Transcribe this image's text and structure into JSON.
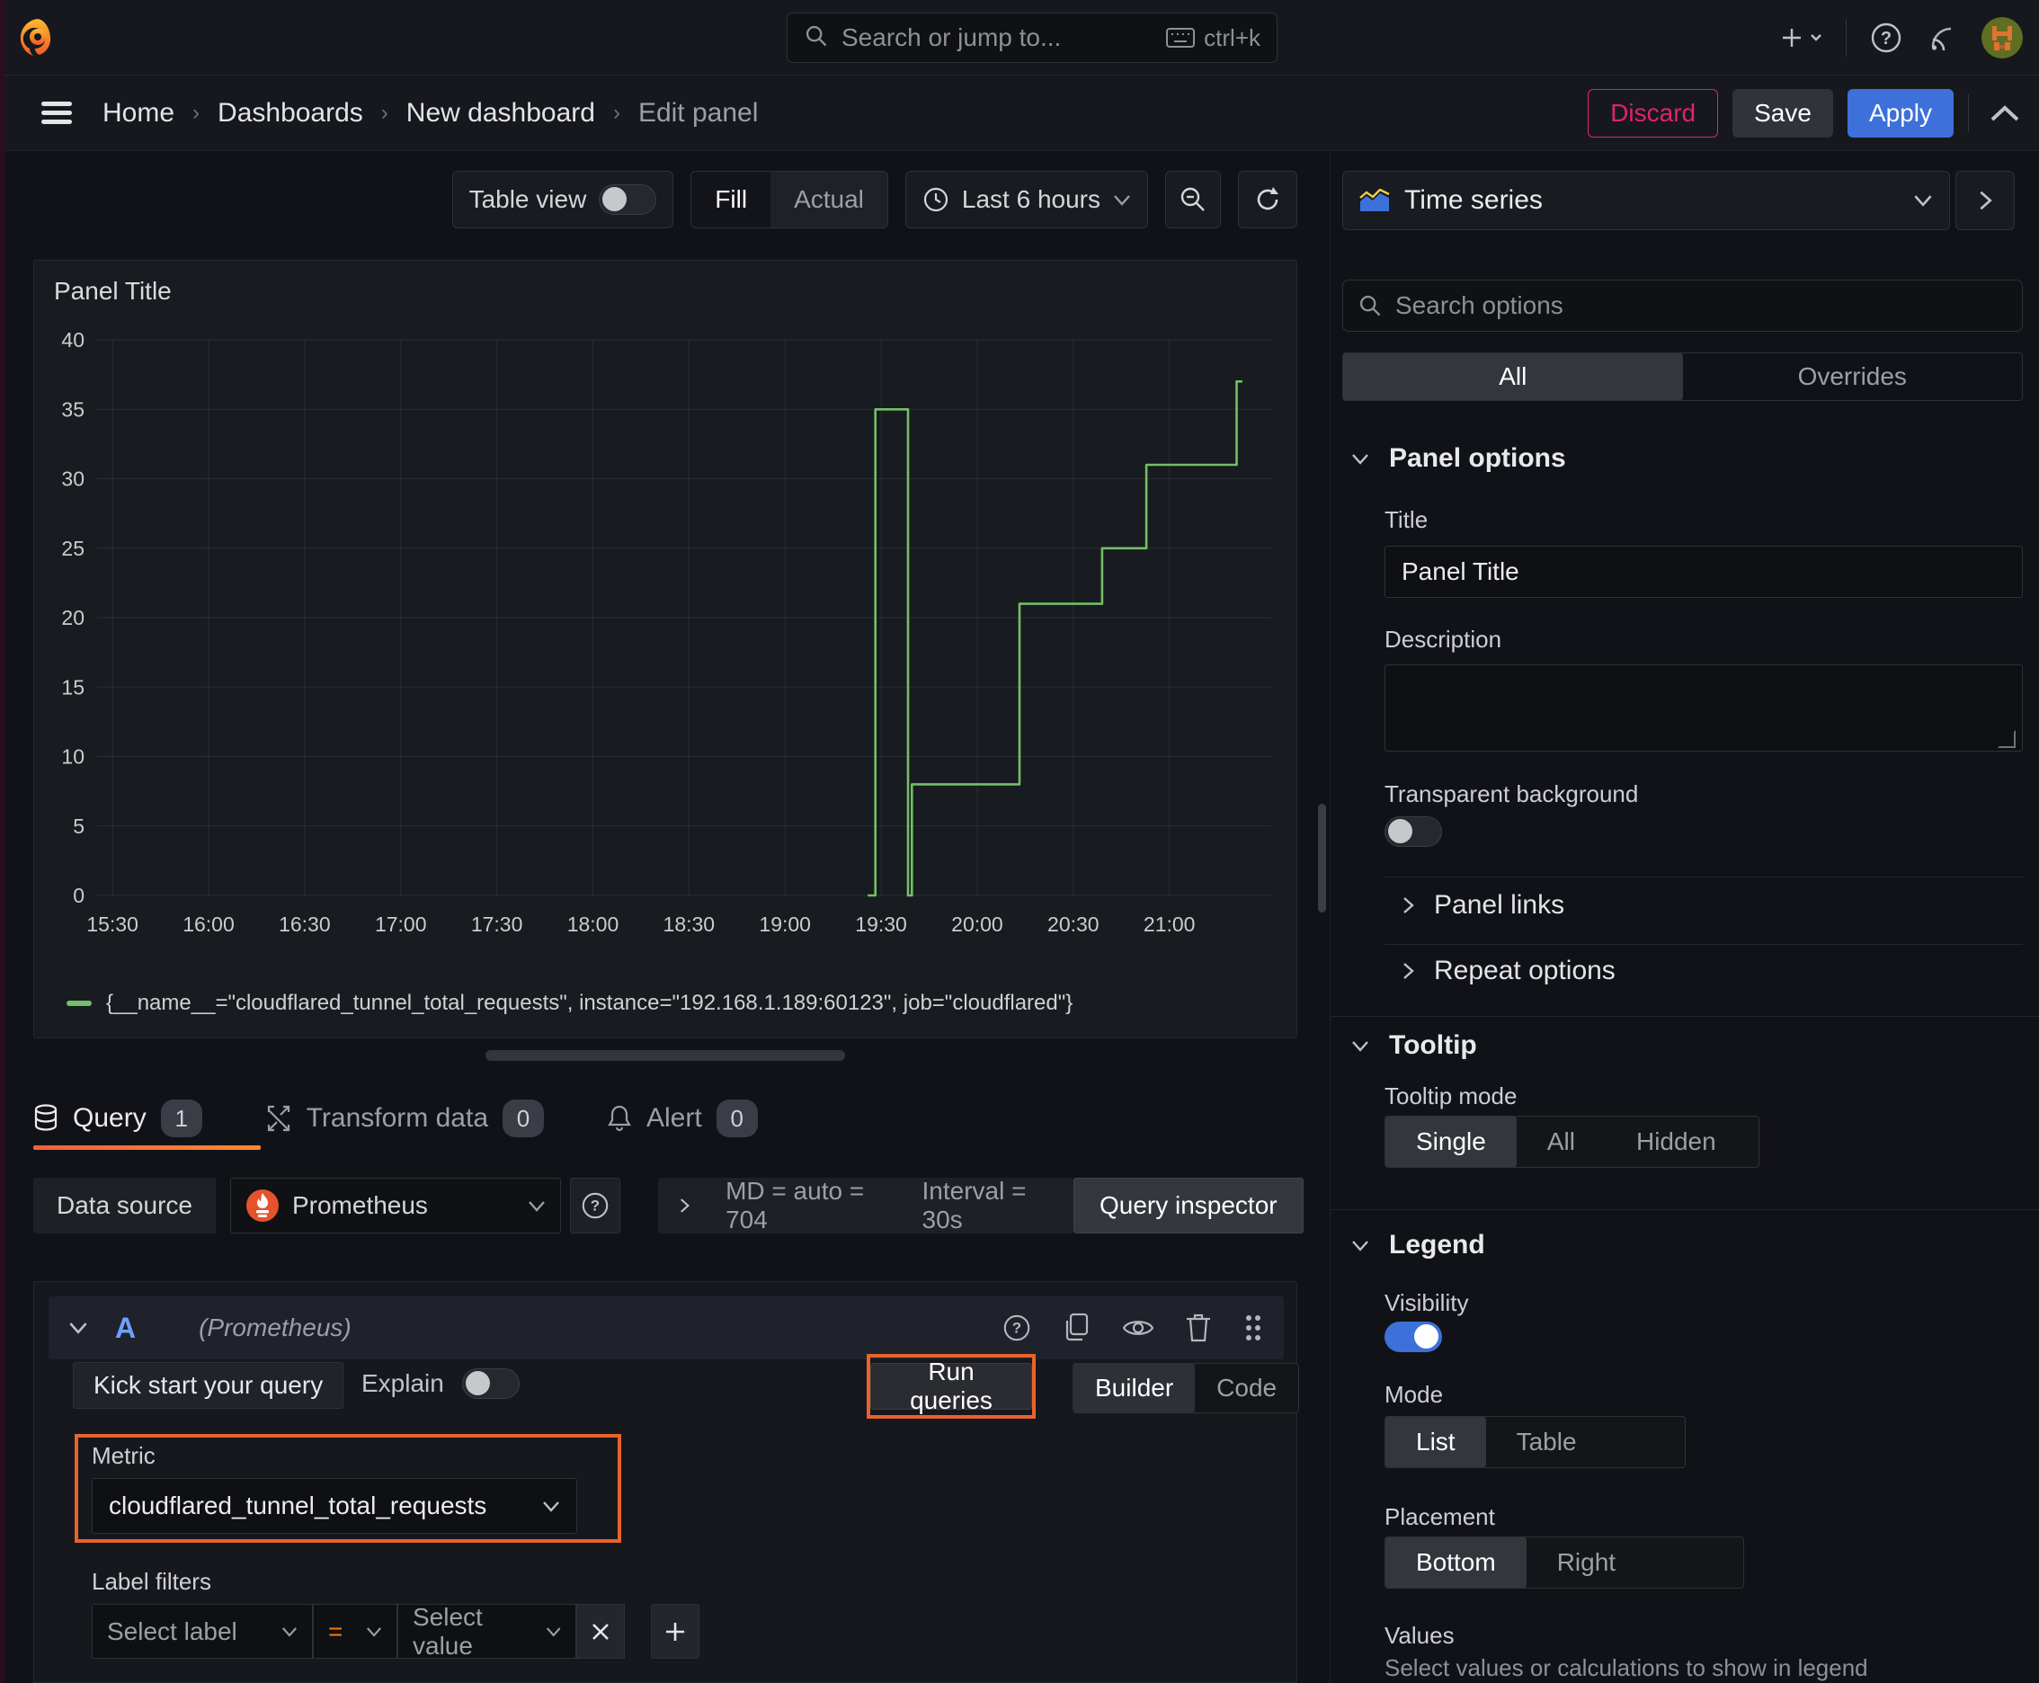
{
  "topnav": {
    "search_placeholder": "Search or jump to...",
    "shortcut": "ctrl+k"
  },
  "breadcrumb": {
    "items": [
      "Home",
      "Dashboards",
      "New dashboard",
      "Edit panel"
    ]
  },
  "actions": {
    "discard": "Discard",
    "save": "Save",
    "apply": "Apply"
  },
  "toolbar": {
    "table_view": "Table view",
    "display_modes": [
      "Fill",
      "Actual"
    ],
    "active_display_mode": "Fill",
    "time_range": "Last 6 hours"
  },
  "panel": {
    "title": "Panel Title"
  },
  "chart_data": {
    "type": "line",
    "interpolation": "step",
    "title": "Panel Title",
    "x_domain": [
      15.42,
      21.53
    ],
    "x_ticks": {
      "start": 15.5,
      "step": 0.5,
      "labels": [
        "15:30",
        "16:00",
        "16:30",
        "17:00",
        "17:30",
        "18:00",
        "18:30",
        "19:00",
        "19:30",
        "20:00",
        "20:30",
        "21:00"
      ]
    },
    "ylim": [
      0,
      40
    ],
    "y_tick_step": 5,
    "grid": true,
    "legend_position": "bottom",
    "series": [
      {
        "name": "{__name__=\"cloudflared_tunnel_total_requests\", instance=\"192.168.1.189:60123\", job=\"cloudflared\"}",
        "color": "#73bf69",
        "points": [
          [
            19.43,
            0
          ],
          [
            19.47,
            0
          ],
          [
            19.47,
            35
          ],
          [
            19.64,
            35
          ],
          [
            19.64,
            0
          ],
          [
            19.66,
            0
          ],
          [
            19.66,
            8
          ],
          [
            20.22,
            8
          ],
          [
            20.22,
            21
          ],
          [
            20.65,
            21
          ],
          [
            20.65,
            25
          ],
          [
            20.88,
            25
          ],
          [
            20.88,
            31
          ],
          [
            21.35,
            31
          ],
          [
            21.35,
            37
          ],
          [
            21.38,
            37
          ]
        ]
      }
    ]
  },
  "query_section": {
    "tabs": [
      {
        "label": "Query",
        "count": "1"
      },
      {
        "label": "Transform data",
        "count": "0"
      },
      {
        "label": "Alert",
        "count": "0"
      }
    ],
    "active_tab": "Query",
    "datasource_label": "Data source",
    "datasource_name": "Prometheus",
    "max_data_points": "MD = auto = 704",
    "interval": "Interval = 30s",
    "query_inspector": "Query inspector",
    "row_id": "A",
    "row_datasource": "(Prometheus)",
    "kickstart_label": "Kick start your query",
    "explain_label": "Explain",
    "run_queries_label": "Run queries",
    "editor_modes": [
      "Builder",
      "Code"
    ],
    "active_editor_mode": "Builder",
    "metric_label": "Metric",
    "metric_value": "cloudflared_tunnel_total_requests",
    "label_filters_label": "Label filters",
    "select_label_placeholder": "Select label",
    "operator": "=",
    "select_value_placeholder": "Select value"
  },
  "options_pane": {
    "viz_type": "Time series",
    "search_placeholder": "Search options",
    "tabs": [
      "All",
      "Overrides"
    ],
    "active_tab": "All",
    "panel_options": {
      "header": "Panel options",
      "title_label": "Title",
      "title_value": "Panel Title",
      "description_label": "Description",
      "transparent_label": "Transparent background"
    },
    "collapsed_sections": [
      "Panel links",
      "Repeat options"
    ],
    "tooltip": {
      "header": "Tooltip",
      "mode_label": "Tooltip mode",
      "modes": [
        "Single",
        "All",
        "Hidden"
      ],
      "active_mode": "Single"
    },
    "legend": {
      "header": "Legend",
      "visibility_label": "Visibility",
      "mode_label": "Mode",
      "modes": [
        "List",
        "Table"
      ],
      "active_mode": "List",
      "placement_label": "Placement",
      "placements": [
        "Bottom",
        "Right"
      ],
      "active_placement": "Bottom",
      "values_label": "Values",
      "values_help": "Select values or calculations to show in legend"
    }
  }
}
